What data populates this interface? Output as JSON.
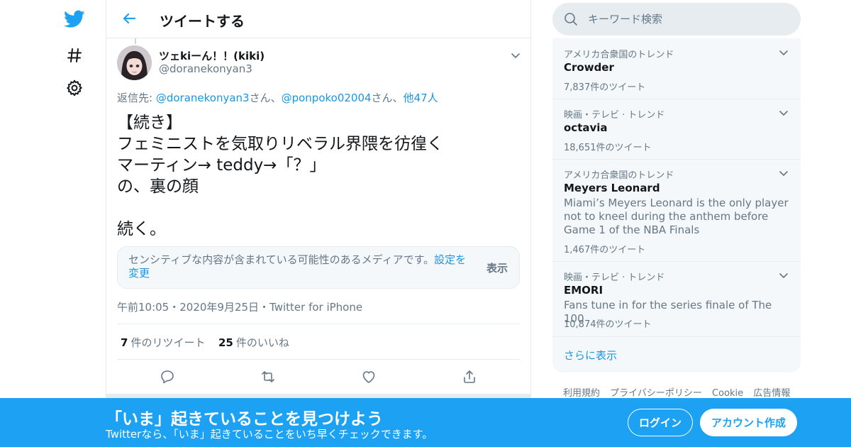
{
  "nav": {
    "icons": [
      "twitter-logo-icon",
      "hashtag-icon",
      "gear-icon"
    ]
  },
  "header": {
    "title": "ツイートする"
  },
  "tweet": {
    "user_name": "ツェkiーん！！(kiki)",
    "handle": "@doranekonyan3",
    "reply_prefix": "返信先: ",
    "reply_user1": "@doranekonyan3",
    "reply_san1": "さん、",
    "reply_user2": "@ponpoko02004",
    "reply_san2": "さん、",
    "reply_others": "他47人",
    "text": "【続き】\nフェミニストを気取りリベラル界隈を彷徨く\nマーティン→ teddy→「？」\nの、裏の顔\n\n続く。",
    "sensitive_text": "センシティブな内容が含まれている可能性のあるメディアです。",
    "sensitive_link": "設定を変更",
    "show_label": "表示",
    "timestamp": "午前10:05・2020年9月25日・Twitter for iPhone",
    "retweet_count": "7",
    "retweet_label": "件のリツイート",
    "like_count": "25",
    "like_label": "件のいいね"
  },
  "search": {
    "placeholder": "キーワード検索"
  },
  "trends": [
    {
      "context": "アメリカ合衆国のトレンド",
      "name": "Crowder",
      "description": "",
      "count": "7,837件のツイート"
    },
    {
      "context": "映画・テレビ · トレンド",
      "name": "octavia",
      "description": "",
      "count": "18,651件のツイート"
    },
    {
      "context": "アメリカ合衆国のトレンド",
      "name": "Meyers Leonard",
      "description": "Miami’s Meyers Leonard is the only player not to kneel during the anthem before Game 1 of the NBA Finals",
      "count": "1,467件のツイート"
    },
    {
      "context": "映画・テレビ · トレンド",
      "name": "EMORI",
      "description": "Fans tune in for the series finale of The 100",
      "count": "10,874件のツイート"
    }
  ],
  "show_more": "さらに表示",
  "footer_links": [
    "利用規約",
    "プライバシーポリシー",
    "Cookie",
    "広告情報"
  ],
  "banner": {
    "title": "「いま」起きていることを見つけよう",
    "subtitle": "Twitterなら、「いま」起きていることをいち早くチェックできます。",
    "login": "ログイン",
    "signup": "アカウント作成"
  },
  "colors": {
    "accent": "#1da1f2",
    "link": "#1b95e0",
    "muted": "#657786",
    "border": "#e6ecf0",
    "panel": "#f5f8fa"
  }
}
